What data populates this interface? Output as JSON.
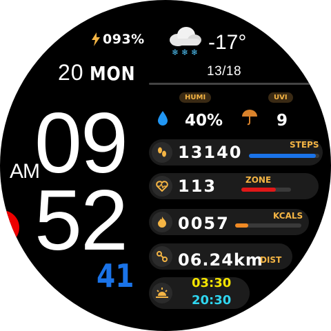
{
  "battery": {
    "value": "093%",
    "color": "#f5b544"
  },
  "date": {
    "day": "20",
    "weekday": "MON"
  },
  "weather": {
    "temperature": "-17°",
    "range": "13/18",
    "condition": "cloud-snow"
  },
  "time": {
    "hour": "09",
    "minute": "52",
    "ampm": "AM",
    "seconds": "41"
  },
  "humidity": {
    "label": "HUMI",
    "value": "40%"
  },
  "uv": {
    "label": "UVI",
    "value": "9"
  },
  "steps": {
    "value": "13140",
    "label": "STEPS",
    "progress": 0.95,
    "color": "#1a73e8"
  },
  "heart": {
    "value": "113",
    "label": "ZONE",
    "progress": 0.7,
    "color": "#e01818"
  },
  "kcals": {
    "value": "0057",
    "label": "KCALS",
    "progress": 0.2,
    "color": "#f08a24"
  },
  "distance": {
    "value": "06.24km",
    "unit": "DIST"
  },
  "sun": {
    "sunrise": "03:30",
    "sunset": "20:30",
    "sunrise_color": "#f5e400",
    "sunset_color": "#2fd6f0"
  }
}
